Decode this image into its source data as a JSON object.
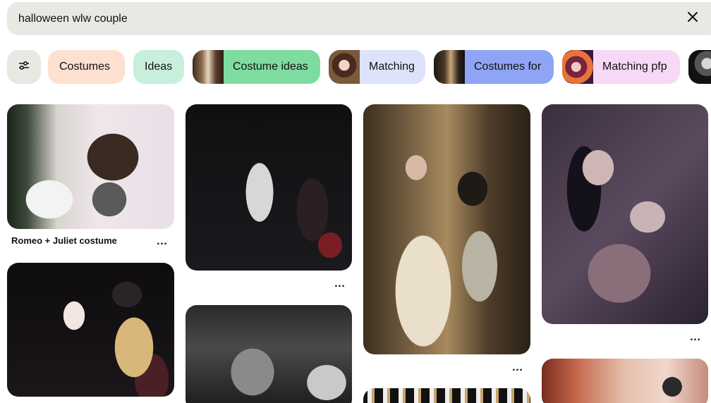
{
  "search": {
    "query": "halloween wlw couple"
  },
  "chips": [
    {
      "label": "Costumes",
      "bg": "#fde0cf"
    },
    {
      "label": "Ideas",
      "bg": "#c8eedc"
    },
    {
      "label": "Costume ideas",
      "bg": "#7fdca0"
    },
    {
      "label": "Matching",
      "bg": "#dde3fb"
    },
    {
      "label": "Costumes for",
      "bg": "#8ea4f5"
    },
    {
      "label": "Matching pfp",
      "bg": "#f7d9f6"
    }
  ],
  "pins": [
    {
      "title": "Romeo + Juliet costume"
    }
  ],
  "colors": {
    "search_bg": "#e9e9e4",
    "filter_bg": "#e9e9e4"
  }
}
